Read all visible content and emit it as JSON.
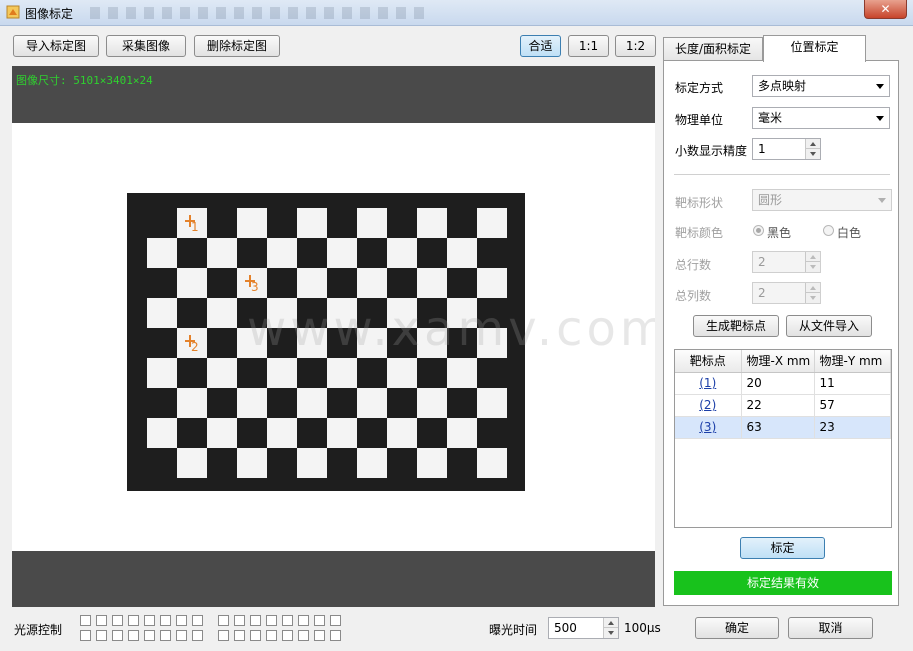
{
  "window": {
    "title": "图像标定",
    "close_label": "✕"
  },
  "toolbar": {
    "import_label": "导入标定图",
    "capture_label": "采集图像",
    "delete_label": "删除标定图",
    "fit_label": "合适",
    "zoom_1_1_label": "1:1",
    "zoom_1_2_label": "1:2"
  },
  "viewer": {
    "image_size_text": "图像尺寸: 5101×3401×24",
    "watermark_text": "www.xamv.com",
    "markers": [
      {
        "num": "1",
        "row": 0,
        "col": 1
      },
      {
        "num": "3",
        "row": 2,
        "col": 3
      },
      {
        "num": "2",
        "row": 4,
        "col": 1
      }
    ]
  },
  "tabs": [
    {
      "label": "长度/面积标定",
      "active": false
    },
    {
      "label": "位置标定",
      "active": true
    }
  ],
  "panel": {
    "method_label": "标定方式",
    "method_value": "多点映射",
    "unit_label": "物理单位",
    "unit_value": "毫米",
    "precision_label": "小数显示精度",
    "precision_value": "1",
    "shape_label": "靶标形状",
    "shape_value": "圆形",
    "color_label": "靶标颜色",
    "color_black": "黑色",
    "color_white": "白色",
    "rows_label": "总行数",
    "rows_value": "2",
    "cols_label": "总列数",
    "cols_value": "2",
    "generate_label": "生成靶标点",
    "import_file_label": "从文件导入",
    "table": {
      "headers": [
        "靶标点",
        "物理-X mm",
        "物理-Y mm"
      ],
      "rows": [
        {
          "idx": "(1)",
          "x": "20",
          "y": "11"
        },
        {
          "idx": "(2)",
          "x": "22",
          "y": "57"
        },
        {
          "idx": "(3)",
          "x": "63",
          "y": "23"
        }
      ]
    },
    "calibrate_label": "标定",
    "result_text": "标定结果有效"
  },
  "footer": {
    "light_label": "光源控制",
    "exposure_label": "曝光时间",
    "exposure_value": "500",
    "exposure_unit": "100μs",
    "ok_label": "确定",
    "cancel_label": "取消"
  },
  "colors": {
    "status_ok": "#18c21c",
    "marker": "#e4822b",
    "image_size_text": "#2fd02f"
  }
}
